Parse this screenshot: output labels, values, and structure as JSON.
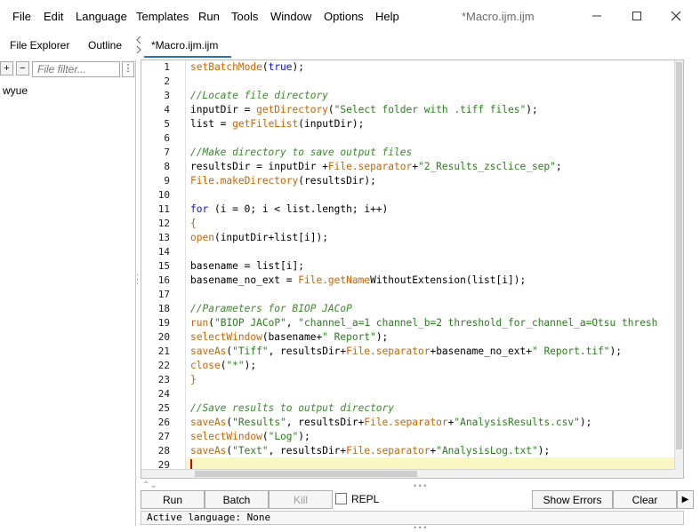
{
  "menu": [
    "File",
    "Edit",
    "Language",
    "Templates",
    "Run",
    "Tools",
    "Window",
    "Options",
    "Help"
  ],
  "window_title": "*Macro.ijm.ijm",
  "window_controls": {
    "minimize": "—",
    "maximize": "☐",
    "close": "✕"
  },
  "side_tabs": {
    "explorer": "File Explorer",
    "outline": "Outline"
  },
  "explorer": {
    "add_label": "+",
    "remove_label": "−",
    "filter_placeholder": "File filter...",
    "menu_label": "⋮",
    "tree_item": "wyue"
  },
  "editor_tab": "*Macro.ijm.ijm",
  "editor": {
    "line_numbers": [
      "1",
      "2",
      "3",
      "4",
      "5",
      "6",
      "7",
      "8",
      "9",
      "10",
      "11",
      "12",
      "13",
      "14",
      "15",
      "16",
      "17",
      "18",
      "19",
      "20",
      "21",
      "22",
      "23",
      "24",
      "25",
      "26",
      "27",
      "28",
      "29"
    ],
    "current_line": 29,
    "lines": [
      [
        [
          "fn",
          "setBatchMode"
        ],
        [
          "tx",
          "("
        ],
        [
          "kw",
          "true"
        ],
        [
          "tx",
          ");"
        ]
      ],
      [],
      [
        [
          "cm",
          "//Locate file directory"
        ]
      ],
      [
        [
          "tx",
          "inputDir = "
        ],
        [
          "fn",
          "getDirectory"
        ],
        [
          "tx",
          "("
        ],
        [
          "st",
          "\"Select folder with .tiff files\""
        ],
        [
          "tx",
          ");"
        ]
      ],
      [
        [
          "tx",
          "list = "
        ],
        [
          "fn",
          "getFileList"
        ],
        [
          "tx",
          "(inputDir);"
        ]
      ],
      [],
      [
        [
          "cm",
          "//Make directory to save output files"
        ]
      ],
      [
        [
          "tx",
          "resultsDir = inputDir +"
        ],
        [
          "fn",
          "File.separator"
        ],
        [
          "tx",
          "+"
        ],
        [
          "st",
          "\"2_Results_zsclice_sep\""
        ],
        [
          "tx",
          ";"
        ]
      ],
      [
        [
          "fn",
          "File.makeDirectory"
        ],
        [
          "tx",
          "(resultsDir);"
        ]
      ],
      [],
      [
        [
          "kw",
          "for"
        ],
        [
          "tx",
          " (i = 0; i < list.length; i++)"
        ]
      ],
      [
        [
          "fn",
          "{"
        ]
      ],
      [
        [
          "fn",
          "open"
        ],
        [
          "tx",
          "(inputDir+list[i]);"
        ]
      ],
      [],
      [
        [
          "tx",
          "basename = list[i];"
        ]
      ],
      [
        [
          "tx",
          "basename_no_ext = "
        ],
        [
          "fn",
          "File.getName"
        ],
        [
          "tx",
          "WithoutExtension(list[i]);"
        ]
      ],
      [],
      [
        [
          "cm",
          "//Parameters for BIOP JACoP"
        ]
      ],
      [
        [
          "fn",
          "run"
        ],
        [
          "tx",
          "("
        ],
        [
          "st",
          "\"BIOP JACoP\""
        ],
        [
          "tx",
          ", "
        ],
        [
          "st",
          "\"channel_a=1 channel_b=2 threshold_for_channel_a=Otsu thresh"
        ]
      ],
      [
        [
          "fn",
          "selectWindow"
        ],
        [
          "tx",
          "(basename+"
        ],
        [
          "st",
          "\" Report\""
        ],
        [
          "tx",
          ");"
        ]
      ],
      [
        [
          "fn",
          "saveAs"
        ],
        [
          "tx",
          "("
        ],
        [
          "st",
          "\"Tiff\""
        ],
        [
          "tx",
          ", resultsDir+"
        ],
        [
          "fn",
          "File.separator"
        ],
        [
          "tx",
          "+basename_no_ext+"
        ],
        [
          "st",
          "\" Report.tif\""
        ],
        [
          "tx",
          ");"
        ]
      ],
      [
        [
          "fn",
          "close"
        ],
        [
          "tx",
          "("
        ],
        [
          "st",
          "\"*\""
        ],
        [
          "tx",
          ");"
        ]
      ],
      [
        [
          "fn",
          "}"
        ]
      ],
      [],
      [
        [
          "cm",
          "//Save results to output directory"
        ]
      ],
      [
        [
          "fn",
          "saveAs"
        ],
        [
          "tx",
          "("
        ],
        [
          "st",
          "\"Results\""
        ],
        [
          "tx",
          ", resultsDir+"
        ],
        [
          "fn",
          "File.separator"
        ],
        [
          "tx",
          "+"
        ],
        [
          "st",
          "\"AnalysisResults.csv\""
        ],
        [
          "tx",
          ");"
        ]
      ],
      [
        [
          "fn",
          "selectWindow"
        ],
        [
          "tx",
          "("
        ],
        [
          "st",
          "\"Log\""
        ],
        [
          "tx",
          ");"
        ]
      ],
      [
        [
          "fn",
          "saveAs"
        ],
        [
          "tx",
          "("
        ],
        [
          "st",
          "\"Text\""
        ],
        [
          "tx",
          ", resultsDir+"
        ],
        [
          "fn",
          "File.separator"
        ],
        [
          "tx",
          "+"
        ],
        [
          "st",
          "\"AnalysisLog.txt\""
        ],
        [
          "tx",
          ");"
        ]
      ],
      []
    ]
  },
  "buttons": {
    "run": "Run",
    "batch": "Batch",
    "kill": "Kill",
    "repl": "REPL",
    "show_errors": "Show Errors",
    "clear": "Clear",
    "play": "▶"
  },
  "status": "Active language: None",
  "colors": {
    "keyword": "#1010c8",
    "function": "#c86400",
    "string": "#2a7d1c",
    "comment": "#3c8a2c",
    "current_line": "#fbf7c2",
    "tab_underline": "#2c6fbf"
  }
}
